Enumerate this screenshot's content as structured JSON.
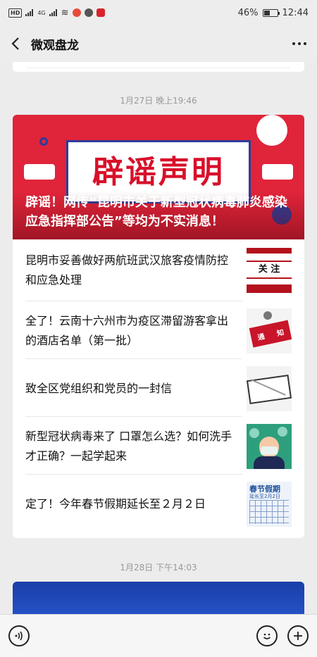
{
  "status_bar": {
    "chip_hd1": "HD",
    "chip_hd2": "HD",
    "network": "4G",
    "battery_pct": "46%",
    "battery_level": 0.46,
    "time": "12:44"
  },
  "nav": {
    "title": "微观盘龙",
    "back_icon": "chevron-left-icon",
    "more_icon": "more-horizontal-icon"
  },
  "messages": [
    {
      "timestamp": "1月27日 晚上19:46",
      "hero": {
        "sign_text": "辟谣声明",
        "title": "辟谣！网传“昆明市关于新型冠状病毒肺炎感染应急指挥部公告”等均为不实消息！"
      },
      "items": [
        {
          "title": "昆明市妥善做好两航班武汉旅客疫情防控和应急处理",
          "thumb_text": "关 注"
        },
        {
          "title": "全了！云南十六州市为疫区滞留游客拿出的酒店名单（第一批）",
          "thumb_text_1": "通",
          "thumb_text_2": "知"
        },
        {
          "title": "致全区党组织和党员的一封信"
        },
        {
          "title": "新型冠状病毒来了 口罩怎么选？如何洗手才正确？一起学起来"
        },
        {
          "title": "定了！今年春节假期延长至２月２日",
          "thumb_title": "春节假期",
          "thumb_sub": "延长至2月2日"
        }
      ]
    },
    {
      "timestamp": "1月28日 下午14:03"
    }
  ],
  "bottom_bar": {
    "voice_icon": "voice-icon",
    "emoji_icon": "emoji-icon",
    "plus_icon": "plus-icon"
  },
  "colors": {
    "hero_red": "#e0243a",
    "sign_frame": "#2c3c9a",
    "next_card_blue": "#1a3ea8"
  }
}
